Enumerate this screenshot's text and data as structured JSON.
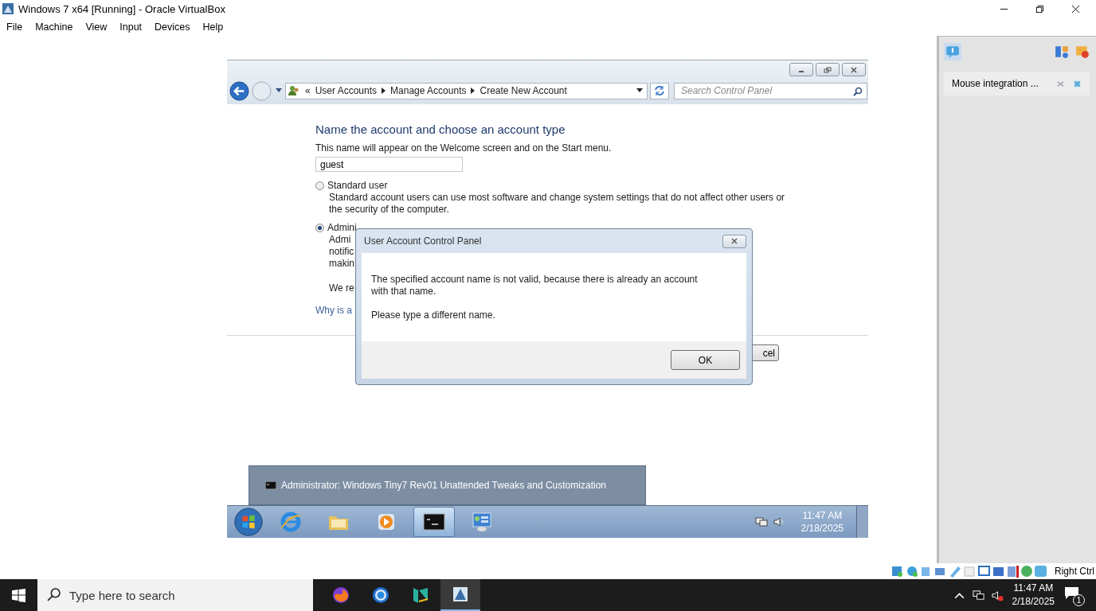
{
  "host_window": {
    "title": "Windows 7 x64 [Running] - Oracle VirtualBox",
    "menu": [
      "File",
      "Machine",
      "View",
      "Input",
      "Devices",
      "Help"
    ]
  },
  "guest": {
    "explorer": {
      "breadcrumb_prefix": "«",
      "breadcrumb": [
        "User Accounts",
        "Manage Accounts",
        "Create New Account"
      ],
      "search": {
        "placeholder": "Search Control Panel"
      },
      "heading": "Name the account and choose an account type",
      "prompt": "This name will appear on the Welcome screen and on the Start menu.",
      "name_field": {
        "value": "guest"
      },
      "account_types": [
        {
          "label": "Standard user",
          "selected": false,
          "description_lines": [
            "Standard account users can use most software and change system settings that do not affect other users or",
            "the security of the computer."
          ]
        },
        {
          "label": "Admini",
          "selected": true,
          "description_lines": [
            "Admi",
            "notific",
            "makin"
          ]
        }
      ],
      "note": "We re",
      "link": "Why is a",
      "button": "cel"
    },
    "dialog": {
      "title": "User Account Control Panel",
      "message": [
        "The specified account name is not valid, because there is already an account with that name.",
        "Please type a different name."
      ],
      "button": "OK"
    },
    "console_preview": {
      "title": "Administrator:  Windows Tiny7 Rev01 Unattended Tweaks and Customization"
    },
    "taskbar": {
      "items": [
        {
          "kind": "ie",
          "selected": false
        },
        {
          "kind": "folder",
          "selected": false
        },
        {
          "kind": "media",
          "selected": false
        },
        {
          "kind": "console",
          "selected": true
        },
        {
          "kind": "control-panel",
          "selected": false
        }
      ],
      "time": "11:47 AM",
      "date": "2/18/2025"
    }
  },
  "side_panel": {
    "notice": "Mouse integration ..."
  },
  "status_bar": {
    "host_key": "Right Ctrl"
  },
  "host_taskbar": {
    "search": {
      "placeholder": "Type here to search"
    },
    "apps": [
      {
        "kind": "firefox",
        "selected": false
      },
      {
        "kind": "chrome",
        "selected": false
      },
      {
        "kind": "editor",
        "selected": false
      },
      {
        "kind": "virtualbox",
        "selected": true
      }
    ],
    "time": "11:47 AM",
    "date": "2/18/2025",
    "notification_count": "1"
  }
}
